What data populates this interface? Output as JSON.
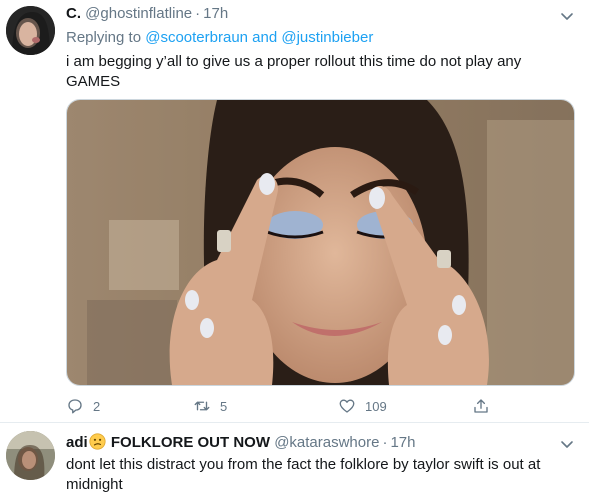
{
  "tweet1": {
    "display_name": "C.",
    "handle": "@ghostinflatline",
    "time": "17h",
    "reply_prefix": "Replying to",
    "reply_mention_1": "@scooterbraun",
    "reply_and": "and",
    "reply_mention_2": "@justinbieber",
    "text": "i am begging y’all to give us a proper rollout this time do not play any GAMES",
    "reply_count": "2",
    "retweet_count": "5",
    "like_count": "109"
  },
  "tweet2": {
    "display_name_prefix": "adi",
    "display_name_suffix": "FOLKLORE OUT NOW",
    "handle": "@kataraswhore",
    "time": "17h",
    "text": "dont let this distract you from the fact the folklore by taylor swift is out at midnight"
  },
  "icons": {
    "reply": "reply-icon",
    "retweet": "retweet-icon",
    "like": "heart-icon",
    "share": "share-icon",
    "more": "chevron-down-icon",
    "emoji": "confused-face-emoji"
  },
  "colors": {
    "link": "#1da1f2",
    "secondary_text": "#657786",
    "primary_text": "#14171a",
    "divider": "#e6ecf0"
  }
}
